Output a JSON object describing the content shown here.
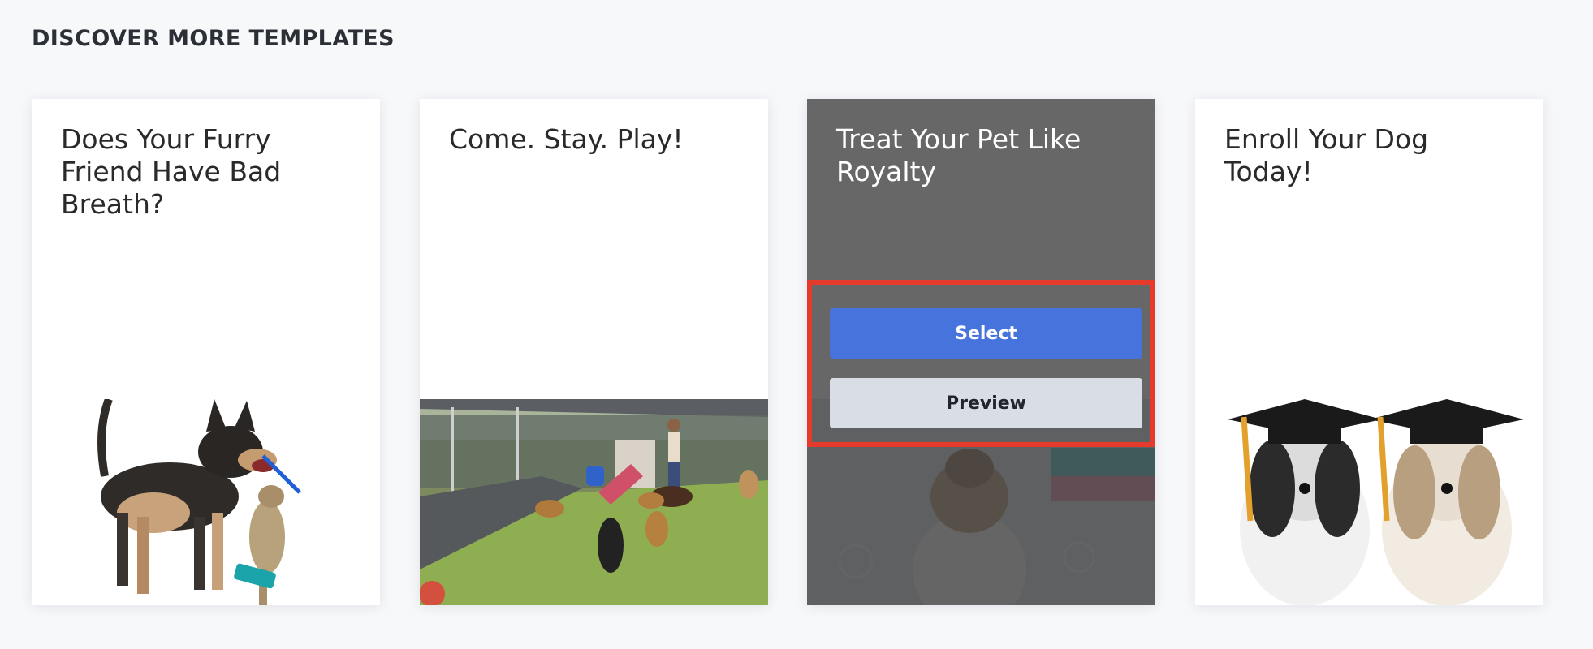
{
  "section": {
    "heading": "DISCOVER MORE TEMPLATES"
  },
  "cards": [
    {
      "title": "Does Your Furry Friend Have Bad Breath?",
      "image": "dog-and-kitten-with-toothbrush-photo"
    },
    {
      "title": "Come. Stay. Play!",
      "image": "dog-daycare-play-yard-photo"
    },
    {
      "title": "Treat Your Pet Like Royalty",
      "image": "yorkie-in-bathrobe-photo",
      "state": "hovered",
      "actions": {
        "select_label": "Select",
        "preview_label": "Preview"
      }
    },
    {
      "title": "Enroll Your Dog Today!",
      "image": "dogs-in-graduation-caps-photo"
    }
  ],
  "colors": {
    "page_background": "#f7f8fa",
    "select_button": "#4674dc",
    "preview_button": "#d9dde6",
    "highlight_border": "#e53a2c"
  }
}
